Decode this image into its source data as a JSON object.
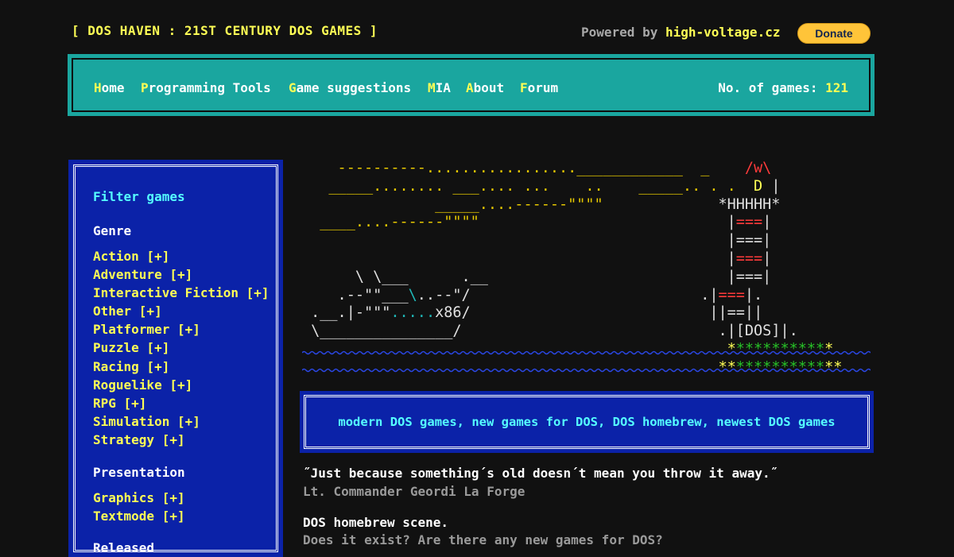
{
  "header": {
    "site_title": "[ DOS HAVEN : 21ST CENTURY DOS GAMES ]",
    "powered_prefix": "Powered by ",
    "powered_link": "high-voltage.cz",
    "donate_label": "Donate"
  },
  "nav": {
    "items": [
      {
        "hot": "H",
        "rest": "ome"
      },
      {
        "hot": "P",
        "rest": "rogramming Tools"
      },
      {
        "hot": "G",
        "rest": "ame suggestions"
      },
      {
        "hot": "M",
        "rest": "IA"
      },
      {
        "hot": "A",
        "rest": "bout"
      },
      {
        "hot": "F",
        "rest": "orum"
      }
    ],
    "count_label": "No. of games: ",
    "count_value": "121"
  },
  "sidebar": {
    "filter_title": "Filter games",
    "genre_title": "Genre",
    "genres": [
      "Action [+]",
      "Adventure [+]",
      "Interactive Fiction [+]",
      "Other [+]",
      "Platformer [+]",
      "Puzzle [+]",
      "Racing [+]",
      "Roguelike [+]",
      "RPG [+]",
      "Simulation [+]",
      "Strategy [+]"
    ],
    "presentation_title": "Presentation",
    "presentations": [
      "Graphics [+]",
      "Textmode [+]"
    ],
    "released_title": "Released"
  },
  "ascii": {
    "boat_label": "x86/",
    "tower_label": "DOS"
  },
  "tagline": "modern DOS games, new games for DOS, DOS homebrew, newest DOS games",
  "quote": {
    "text": "˝Just because something´s old doesn´t mean you throw it away.˝",
    "author": "Lt. Commander Geordi La Forge"
  },
  "scene": {
    "title": "DOS homebrew scene.",
    "question": "Does it exist? Are there any new games for DOS?"
  },
  "colors": {
    "background": "#111111",
    "nav_teal": "#1aa69f",
    "panel_blue": "#0b22a8",
    "yellow": "#ffff55",
    "cyan": "#55ffff",
    "donate_gold": "#ffc439"
  }
}
